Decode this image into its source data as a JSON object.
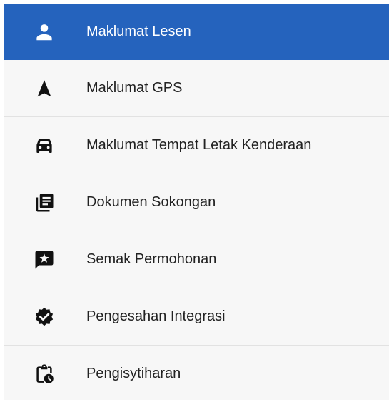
{
  "colors": {
    "active_background": "#2563bd",
    "active_text": "#ffffff",
    "item_background": "#f7f7f7",
    "item_text": "#222222",
    "divider": "#e2e2e2"
  },
  "menu": {
    "active_index": 0,
    "items": [
      {
        "label": "Maklumat Lesen",
        "icon": "person-icon"
      },
      {
        "label": "Maklumat GPS",
        "icon": "navigation-arrow-icon"
      },
      {
        "label": "Maklumat Tempat Letak Kenderaan",
        "icon": "car-icon"
      },
      {
        "label": "Dokumen Sokongan",
        "icon": "library-books-icon"
      },
      {
        "label": "Semak Permohonan",
        "icon": "review-star-icon"
      },
      {
        "label": "Pengesahan Integrasi",
        "icon": "verified-badge-icon"
      },
      {
        "label": "Pengisytiharan",
        "icon": "clipboard-clock-icon"
      }
    ]
  }
}
